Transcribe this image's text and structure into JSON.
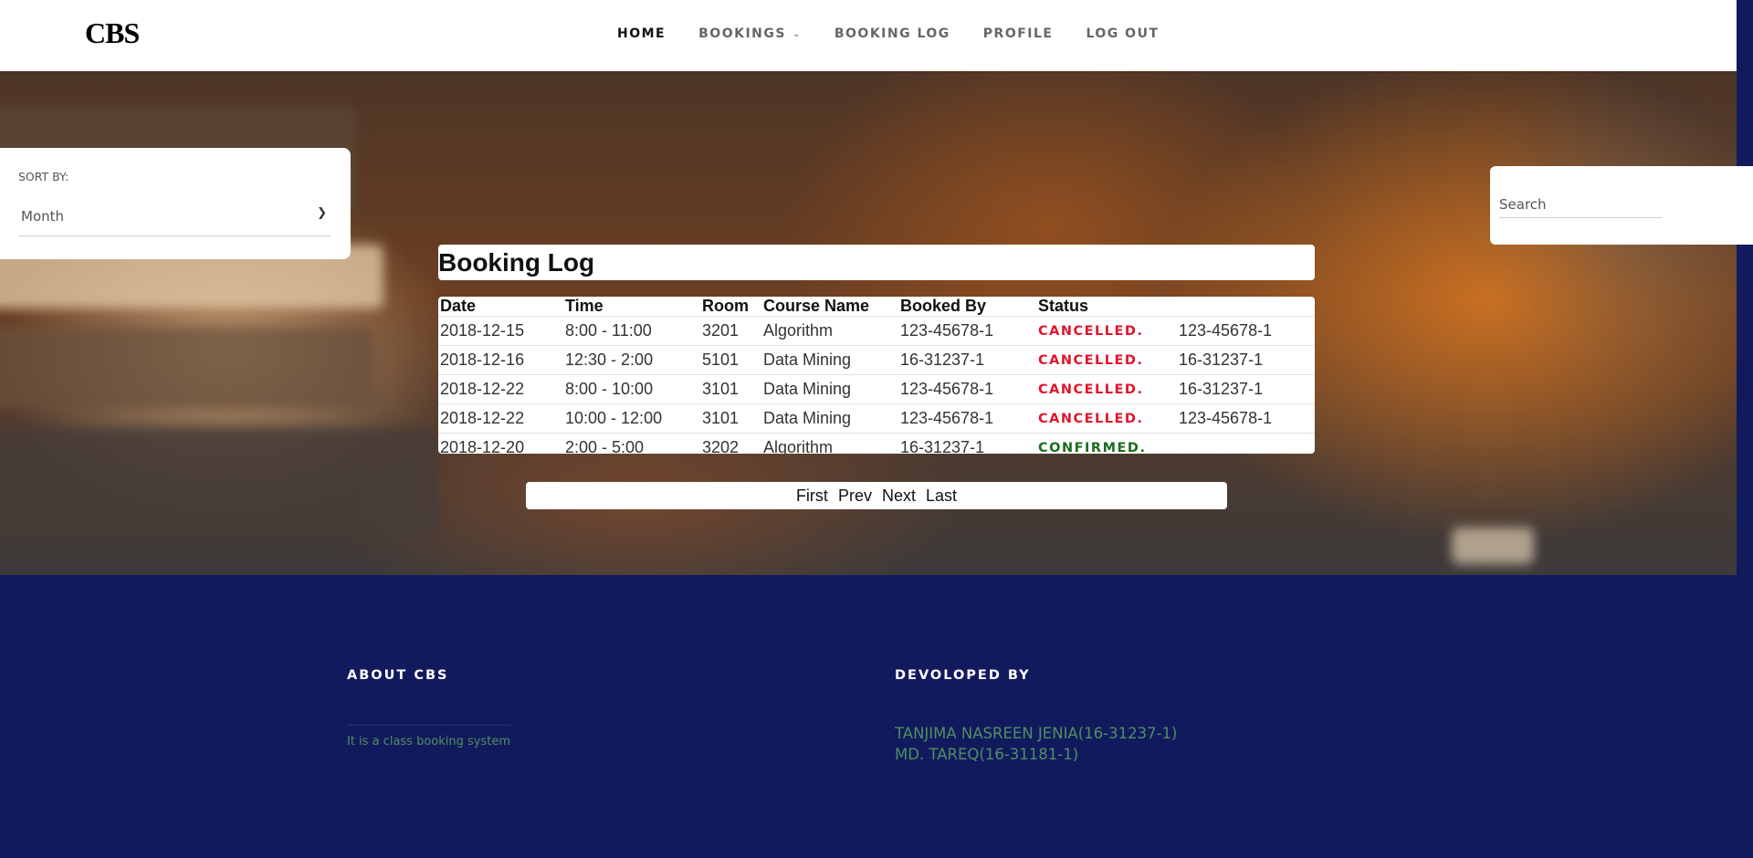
{
  "header": {
    "logo": "CBS",
    "nav": [
      {
        "label": "HOME"
      },
      {
        "label": "BOOKINGS"
      },
      {
        "label": "BOOKING LOG"
      },
      {
        "label": "PROFILE"
      },
      {
        "label": "LOG OUT"
      }
    ]
  },
  "sort": {
    "label": "SORT BY:",
    "selected": "Month"
  },
  "search": {
    "placeholder": "Search"
  },
  "booking_log": {
    "title": "Booking Log",
    "columns": [
      "Date",
      "Time",
      "Room",
      "Course Name",
      "Booked By",
      "Status",
      ""
    ],
    "rows": [
      {
        "date": "2018-12-15",
        "time": "8:00 - 11:00",
        "room": "3201",
        "course": "Algorithm",
        "booked_by": "123-45678-1",
        "status": "CANCELLED.",
        "cancelled_by": "123-45678-1"
      },
      {
        "date": "2018-12-16",
        "time": "12:30 - 2:00",
        "room": "5101",
        "course": "Data Mining",
        "booked_by": "16-31237-1",
        "status": "CANCELLED.",
        "cancelled_by": "16-31237-1"
      },
      {
        "date": "2018-12-22",
        "time": "8:00 - 10:00",
        "room": "3101",
        "course": "Data Mining",
        "booked_by": "123-45678-1",
        "status": "CANCELLED.",
        "cancelled_by": "16-31237-1"
      },
      {
        "date": "2018-12-22",
        "time": "10:00 - 12:00",
        "room": "3101",
        "course": "Data Mining",
        "booked_by": "123-45678-1",
        "status": "CANCELLED.",
        "cancelled_by": "123-45678-1"
      },
      {
        "date": "2018-12-20",
        "time": "2:00 - 5:00",
        "room": "3202",
        "course": "Algorithm",
        "booked_by": "16-31237-1",
        "status": "CONFIRMED.",
        "cancelled_by": ""
      }
    ],
    "status_colors": {
      "cancelled": "#e0152c",
      "confirmed": "#1e6b1e"
    }
  },
  "pagination": {
    "first": "First",
    "prev": "Prev",
    "next": "Next",
    "last": "Last"
  },
  "footer": {
    "about_heading": "ABOUT CBS",
    "about_text": "It is a class booking system",
    "dev_heading": "DEVOLOPED BY",
    "developers": [
      "TANJIMA NASREEN JENIA(16-31237-1)",
      "MD. TAREQ(16-31181-1)"
    ]
  },
  "colors": {
    "footer_bg": "#121a5e",
    "footer_text": "#4f8f5f"
  },
  "icons": {
    "bookings_dropdown": "chevron-down-icon",
    "sort_dropdown": "chevron-down-icon"
  }
}
